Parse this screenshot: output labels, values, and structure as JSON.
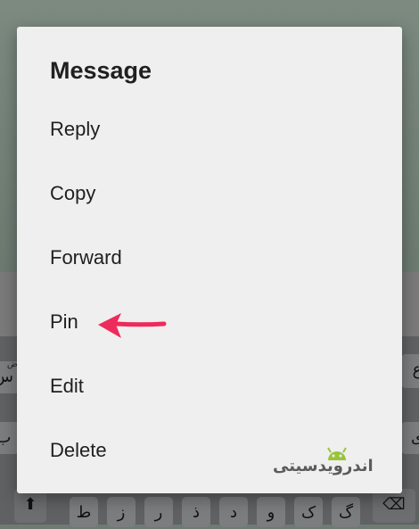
{
  "dialog": {
    "title": "Message",
    "items": [
      {
        "label": "Reply"
      },
      {
        "label": "Copy"
      },
      {
        "label": "Forward"
      },
      {
        "label": "Pin"
      },
      {
        "label": "Edit"
      },
      {
        "label": "Delete"
      }
    ]
  },
  "keyboard": {
    "row1": [
      "س",
      "ع"
    ],
    "row1_hints": [
      "ض"
    ],
    "row2": [
      "ب",
      "ی"
    ],
    "row3": [
      "ط",
      "ز",
      "ر",
      "ذ",
      "د",
      "و",
      "ک",
      "گ"
    ]
  },
  "watermark": {
    "text": "اندرویدسیتی"
  },
  "colors": {
    "arrow": "#ee2b5a",
    "dialog_bg": "#efefef"
  }
}
